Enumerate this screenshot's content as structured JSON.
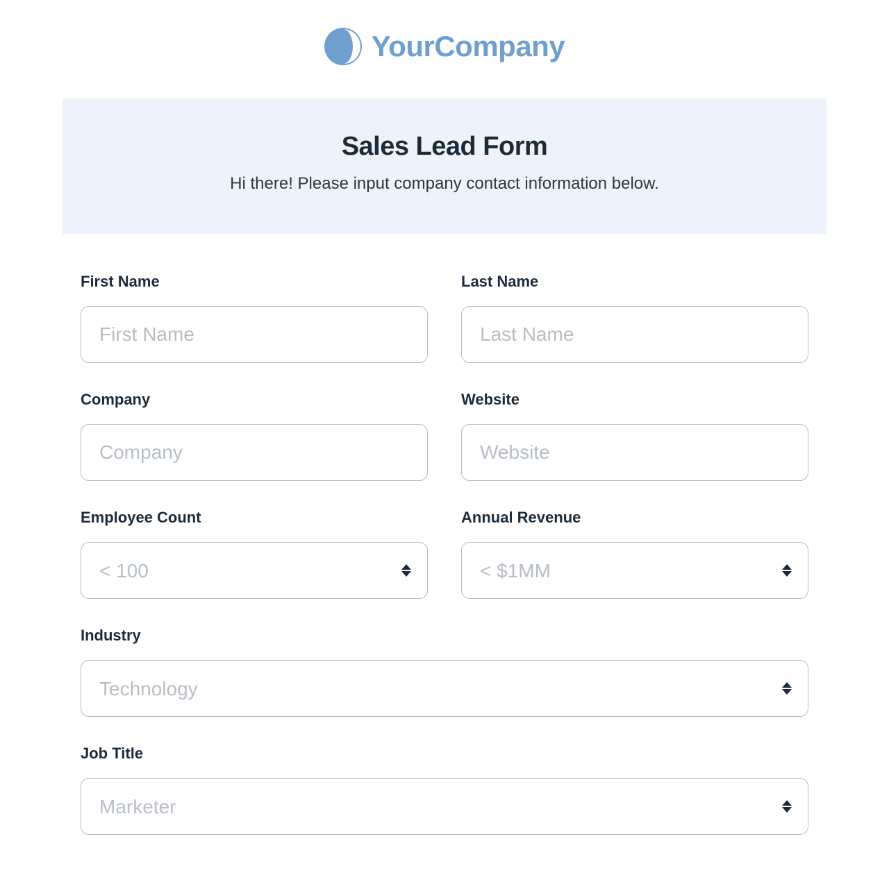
{
  "logo": {
    "text": "YourCompany",
    "icon": "globe-icon"
  },
  "header": {
    "title": "Sales Lead Form",
    "subtitle": "Hi there! Please input company contact information below."
  },
  "fields": {
    "first_name": {
      "label": "First Name",
      "placeholder": "First Name",
      "value": ""
    },
    "last_name": {
      "label": "Last Name",
      "placeholder": "Last Name",
      "value": ""
    },
    "company": {
      "label": "Company",
      "placeholder": "Company",
      "value": ""
    },
    "website": {
      "label": "Website",
      "placeholder": "Website",
      "value": ""
    },
    "employee_count": {
      "label": "Employee Count",
      "selected": "< 100"
    },
    "annual_revenue": {
      "label": "Annual Revenue",
      "selected": "< $1MM"
    },
    "industry": {
      "label": "Industry",
      "selected": "Technology"
    },
    "job_title": {
      "label": "Job Title",
      "selected": "Marketer"
    }
  }
}
